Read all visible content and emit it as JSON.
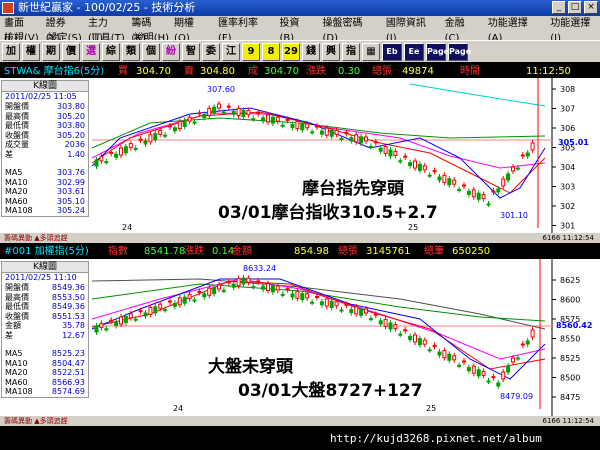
{
  "window": {
    "title": "新世紀贏家 - 100/02/25 - 技術分析"
  },
  "menu": {
    "row1": [
      "畫面(L)",
      "證券(Y)",
      "主力(U)",
      "籌碼(K)",
      "期權(Q)",
      "匯率利率(F)",
      "投資(B)",
      "操盤密碼(D)",
      "國際資訊(I)",
      "金融(C)",
      "功能選擇(A)",
      "功能選擇(J)"
    ],
    "row2": [
      "檢視(V)",
      "設定(S)",
      "工具(T)",
      "說明(H)"
    ]
  },
  "toolbar": [
    "加",
    "權",
    "期",
    "價",
    "選",
    "綜",
    "類",
    "個",
    "紛",
    "智",
    "委",
    "江",
    "9",
    "8",
    "29",
    "錢",
    "興",
    "指",
    "▦",
    "Eb",
    "Ee",
    "Page",
    "Page"
  ],
  "top_panel": {
    "symbol": "STWA& 摩台指6(5分)",
    "buy_label": "買",
    "buy": "304.70",
    "sell_label": "賣",
    "sell": "304.80",
    "deal_label": "成",
    "deal": "304.70",
    "chg_label": "漲跌",
    "chg": "0.30",
    "vol_label": "總張",
    "vol": "49874",
    "time_label": "時間",
    "time": "11:12:50",
    "info_caption": "K線圖",
    "info_date": "2011/02/25 11:05",
    "info_rows": [
      [
        "開盤價",
        "303.80"
      ],
      [
        "最高價",
        "305.20"
      ],
      [
        "最低價",
        "303.80"
      ],
      [
        "收盤價",
        "305.20"
      ],
      [
        "成交量",
        "2036"
      ],
      [
        "差",
        "1.40"
      ]
    ],
    "ma_rows": [
      [
        "MA5",
        "303.76"
      ],
      [
        "MA10",
        "302.99"
      ],
      [
        "MA20",
        "303.61"
      ],
      [
        "MA60",
        "305.10"
      ],
      [
        "MA108",
        "305.24"
      ]
    ],
    "peak_label": "307.60",
    "trough_label": "301.10",
    "price_tag": "305.01",
    "axis_ticks": [
      "308",
      "307",
      "306",
      "305",
      "304",
      "303",
      "302",
      "301"
    ],
    "date_labels": [
      "24",
      "25"
    ],
    "status": "籌碼異動  ▲多頭追趕",
    "status_right": "6166  11:12:54"
  },
  "bottom_panel": {
    "symbol": "#001 加權指(5分)",
    "idx_label": "指數",
    "idx": "8541.78",
    "chg_label": "漲跌",
    "chg": "0.14",
    "amt_label": "金額",
    "amt": "854.98",
    "vol_label": "總張",
    "vol": "3145761",
    "cnt_label": "總筆",
    "cnt": "650250",
    "info_caption": "K線圖",
    "info_date": "2011/02/25 11:10",
    "info_rows": [
      [
        "開盤價",
        "8549.36"
      ],
      [
        "最高價",
        "8553.50"
      ],
      [
        "最低價",
        "8549.36"
      ],
      [
        "收盤價",
        "8551.53"
      ],
      [
        "金額",
        "35.78"
      ],
      [
        "差",
        "12.67"
      ]
    ],
    "ma_rows": [
      [
        "MA5",
        "8525.23"
      ],
      [
        "MA10",
        "8504.47"
      ],
      [
        "MA20",
        "8522.51"
      ],
      [
        "MA60",
        "8566.93"
      ],
      [
        "MA108",
        "8574.69"
      ]
    ],
    "peak_label": "8633.24",
    "trough_label": "8479.09",
    "price_tag": "8560.42",
    "axis_ticks": [
      "8625",
      "8600",
      "8575",
      "8550",
      "8525",
      "8500",
      "8475"
    ],
    "date_labels": [
      "24",
      "25"
    ],
    "status": "籌碼異動  ▲多頭追趕",
    "status_right": "6166  11:12:54"
  },
  "annotations": {
    "top_line1": "摩台指先穿頭",
    "top_line2": "03/01摩台指收310.5+2.7",
    "bottom_line1": "大盤未穿頭",
    "bottom_line2": "03/01大盤8727+127"
  },
  "watermark": "http://kujd3268.pixnet.net/album"
}
